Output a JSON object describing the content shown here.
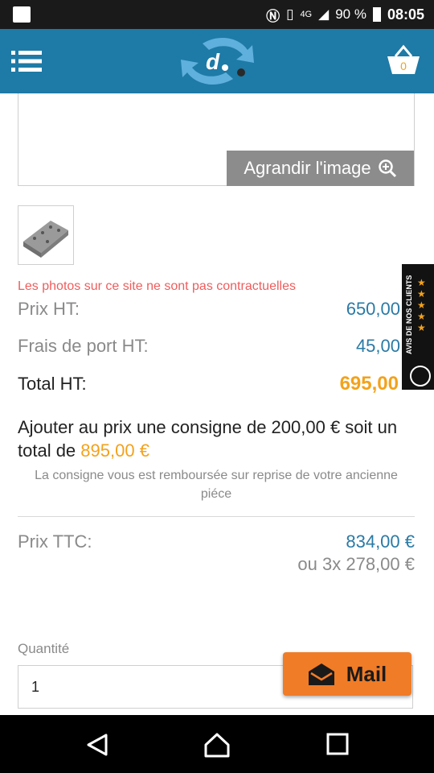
{
  "status_bar": {
    "battery": "90 %",
    "network": "4G",
    "time": "08:05"
  },
  "header": {
    "logo_icon": "site-logo",
    "menu_icon": "hamburger-menu-icon",
    "cart_icon": "basket-icon",
    "cart_count": "0",
    "color": "#1e7aa6"
  },
  "product": {
    "enlarge_label": "Agrandir l'image",
    "disclaimer": "Les photos sur ce site ne sont pas contractuelles",
    "price_ht_label": "Prix HT:",
    "price_ht_value": "650,00",
    "shipping_label": "Frais de port HT:",
    "shipping_value": "45,00",
    "total_label": "Total HT:",
    "total_value": "695,00 €",
    "deposit_text": "Ajouter au prix une consigne de 200,00 € soit un total de",
    "deposit_total": "895,00 €",
    "deposit_note": "La consigne vous est remboursée sur reprise de votre ancienne piéce",
    "ttc_label": "Prix TTC:",
    "ttc_value": "834,00 €",
    "installments": "ou 3x 278,00 €",
    "quantity_label": "Quantité",
    "quantity_value": "1"
  },
  "mail_button": {
    "label": "Mail",
    "color": "#f07c27"
  },
  "reviews_widget": {
    "label": "AVIS DE NOS CLIENTS",
    "rating_stars": 5
  },
  "accent_color": "#f3a21b"
}
